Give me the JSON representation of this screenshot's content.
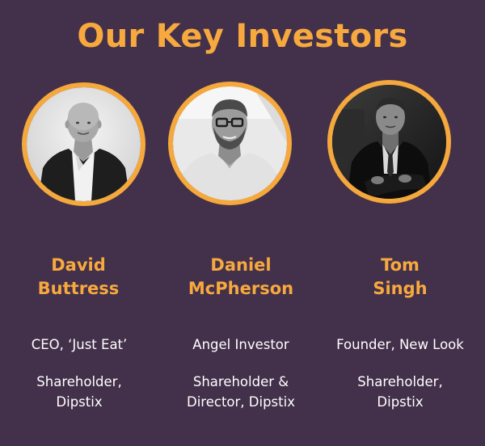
{
  "page": {
    "title": "Our Key Investors"
  },
  "colors": {
    "background": "#43304a",
    "accent": "#f5a83c",
    "text": "#ffffff"
  },
  "investors": [
    {
      "name_line1": "David",
      "name_line2": "Buttress",
      "role": "CEO, ‘Just Eat’",
      "holding_line1": "Shareholder,",
      "holding_line2": "Dipstix",
      "photo": "black-and-white portrait of a bald man in a dark suit"
    },
    {
      "name_line1": "Daniel",
      "name_line2": "McPherson",
      "role": "Angel Investor",
      "holding_line1": "Shareholder &",
      "holding_line2": "Director, Dipstix",
      "photo": "black-and-white portrait of a bearded man with glasses"
    },
    {
      "name_line1": "Tom",
      "name_line2": "Singh",
      "role": "Founder, New Look",
      "holding_line1": "Shareholder,",
      "holding_line2": "Dipstix",
      "photo": "black-and-white portrait of a seated man in a suit and tie"
    }
  ]
}
